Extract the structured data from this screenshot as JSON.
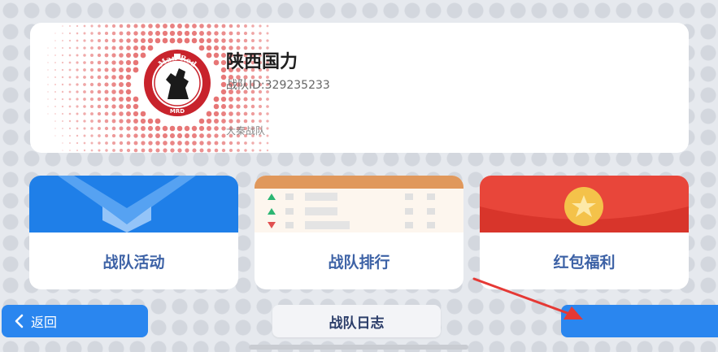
{
  "team": {
    "name": "陕西国力",
    "id_text": "战队ID:329235233",
    "tag": "大秦战队",
    "logo": {
      "top_text": "Man Red",
      "bottom_text": "MRD",
      "color": "#c8232c"
    }
  },
  "tiles": {
    "activity": {
      "label": "战队活动",
      "color": "#1f7fe8"
    },
    "rank": {
      "label": "战队排行",
      "color": "#e0985c"
    },
    "redpack": {
      "label": "红包福利",
      "color": "#e8463a"
    }
  },
  "buttons": {
    "back_label": "返回",
    "log_label": "战队日志"
  },
  "colors": {
    "primary_blue": "#2a86ef",
    "label_blue": "#3d62a6",
    "annotation_arrow": "#e53935"
  }
}
